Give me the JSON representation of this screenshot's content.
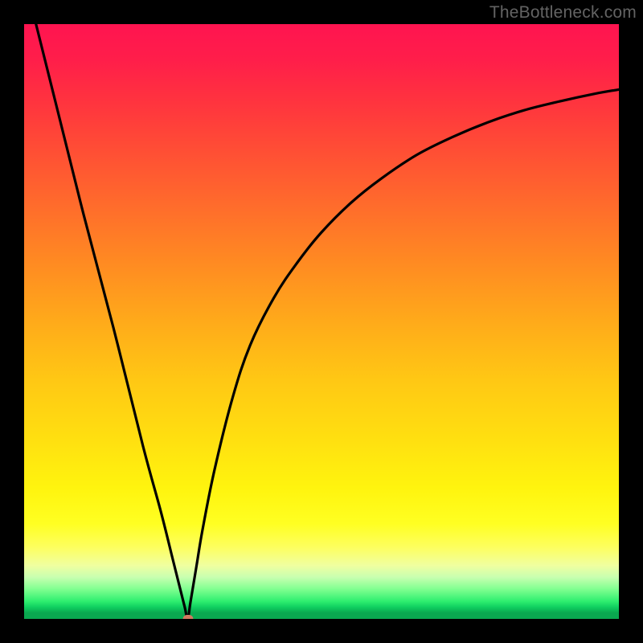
{
  "watermark": "TheBottleneck.com",
  "colors": {
    "frame": "#000000",
    "curve": "#000000",
    "marker": "#d17860"
  },
  "chart_data": {
    "type": "line",
    "title": "",
    "xlabel": "",
    "ylabel": "",
    "xlim": [
      0,
      100
    ],
    "ylim": [
      0,
      100
    ],
    "grid": false,
    "legend": false,
    "annotations": [],
    "series": [
      {
        "name": "left-branch",
        "x": [
          2,
          5,
          10,
          15,
          20,
          23,
          25,
          26,
          27,
          27.5
        ],
        "y": [
          100,
          88,
          68,
          49,
          29,
          18,
          10,
          6,
          2,
          0
        ]
      },
      {
        "name": "right-branch",
        "x": [
          27.5,
          28,
          29,
          30,
          32,
          35,
          38,
          42,
          46,
          50,
          55,
          60,
          66,
          72,
          78,
          84,
          90,
          96,
          100
        ],
        "y": [
          0,
          3,
          9,
          15,
          25,
          37,
          46,
          54,
          60,
          65,
          70,
          74,
          78,
          81,
          83.5,
          85.5,
          87,
          88.3,
          89
        ]
      }
    ],
    "marker": {
      "x": 27.5,
      "y": 0
    }
  }
}
